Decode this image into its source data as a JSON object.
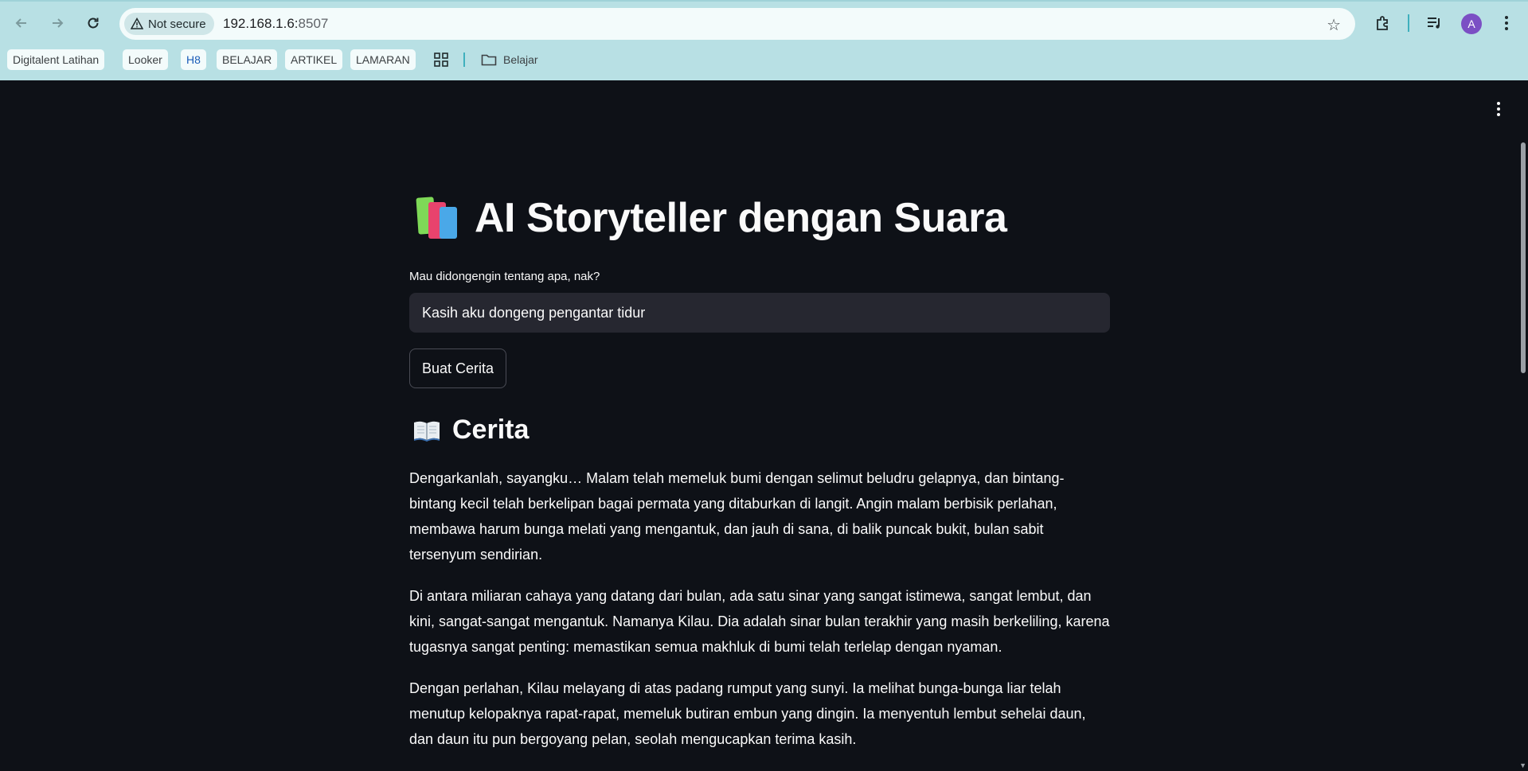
{
  "browser": {
    "security_label": "Not secure",
    "url_host": "192.168.1.6:",
    "url_port": "8507",
    "avatar_letter": "A"
  },
  "bookmarks": [
    "Digitalent Latihan",
    "Looker",
    "H8",
    "BELAJAR",
    "ARTIKEL",
    "LAMARAN"
  ],
  "bookmark_folder": "Belajar",
  "app": {
    "title_icon": "books-emoji",
    "title": "AI Storyteller dengan Suara",
    "input_label": "Mau didongengin tentang apa, nak?",
    "input_value": "Kasih aku dongeng pengantar tidur",
    "button_label": "Buat Cerita",
    "section_icon": "open-book-emoji",
    "section_title": "Cerita",
    "paragraphs": [
      "Dengarkanlah, sayangku… Malam telah memeluk bumi dengan selimut beludru gelapnya, dan bintang-bintang kecil telah berkelipan bagai permata yang ditaburkan di langit. Angin malam berbisik perlahan, membawa harum bunga melati yang mengantuk, dan jauh di sana, di balik puncak bukit, bulan sabit tersenyum sendirian.",
      "Di antara miliaran cahaya yang datang dari bulan, ada satu sinar yang sangat istimewa, sangat lembut, dan kini, sangat-sangat mengantuk. Namanya Kilau. Dia adalah sinar bulan terakhir yang masih berkeliling, karena tugasnya sangat penting: memastikan semua makhluk di bumi telah terlelap dengan nyaman.",
      "Dengan perlahan, Kilau melayang di atas padang rumput yang sunyi. Ia melihat bunga-bunga liar telah menutup kelopaknya rapat-rapat, memeluk butiran embun yang dingin. Ia menyentuh lembut sehelai daun, dan daun itu pun bergoyang pelan, seolah mengucapkan terima kasih."
    ]
  }
}
